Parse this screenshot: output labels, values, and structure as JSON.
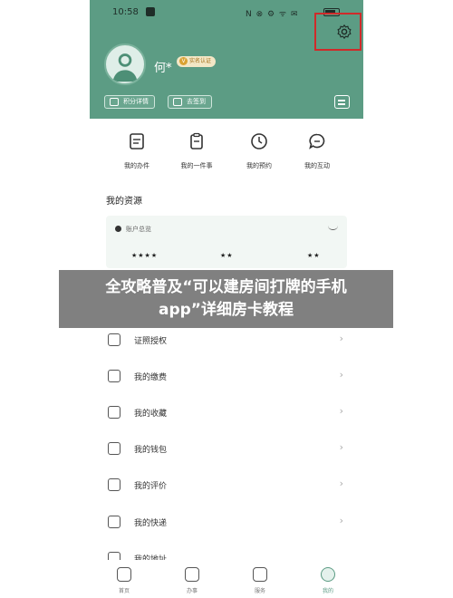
{
  "status_bar": {
    "time": "10:58",
    "icons": "N ⊗ ⚙ ᯤ ✉"
  },
  "profile": {
    "username": "何*",
    "verify_badge": "实名认证",
    "chip_points": "积分详情",
    "chip_signin": "去签到"
  },
  "quick_actions": [
    {
      "label": "我的办件",
      "icon": "document-icon"
    },
    {
      "label": "我的一件事",
      "icon": "clipboard-icon"
    },
    {
      "label": "我的预约",
      "icon": "clock-icon"
    },
    {
      "label": "我的互动",
      "icon": "chat-icon"
    }
  ],
  "assets": {
    "title": "我的资源",
    "account_label": "账户总览",
    "values": [
      "★★★★",
      "★★",
      "★★"
    ]
  },
  "menu": [
    {
      "label": "证照授权",
      "icon": "id-card-icon"
    },
    {
      "label": "我的缴费",
      "icon": "yuan-icon"
    },
    {
      "label": "我的收藏",
      "icon": "star-icon"
    },
    {
      "label": "我的钱包",
      "icon": "wallet-icon"
    },
    {
      "label": "我的评价",
      "icon": "comment-icon"
    },
    {
      "label": "我的快递",
      "icon": "truck-icon"
    },
    {
      "label": "我的地址",
      "icon": "location-icon"
    }
  ],
  "bottom_nav": [
    {
      "label": "首页",
      "icon": "home-icon"
    },
    {
      "label": "办事",
      "icon": "list-icon"
    },
    {
      "label": "服务",
      "icon": "bag-icon"
    },
    {
      "label": "我的",
      "icon": "profile-icon"
    }
  ],
  "banner": {
    "line1": "全攻略普及“可以建房间打牌的手机",
    "line2": "app”详细房卡教程"
  },
  "colors": {
    "header": "#5c9c84",
    "highlight_box": "#d02a2a",
    "banner": "#6e6e6e"
  }
}
